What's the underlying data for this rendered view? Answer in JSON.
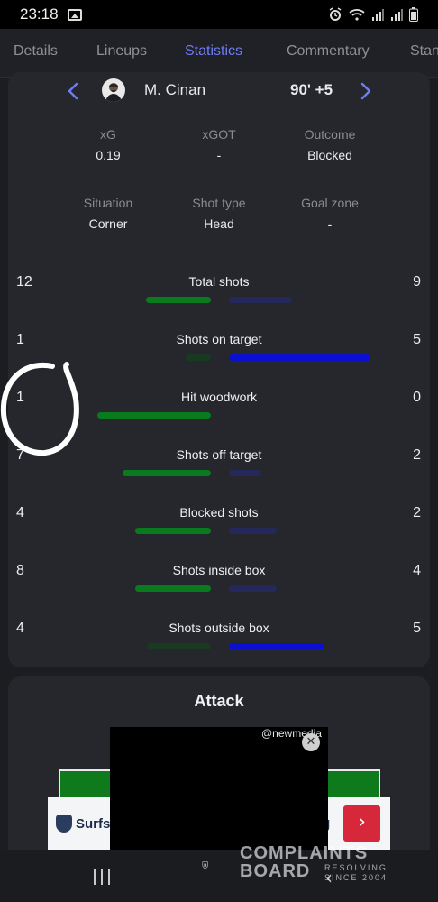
{
  "status_bar": {
    "time": "23:18"
  },
  "tabs": [
    {
      "label": "Details"
    },
    {
      "label": "Lineups"
    },
    {
      "label": "Statistics"
    },
    {
      "label": "Commentary"
    },
    {
      "label": "Stan"
    }
  ],
  "shot": {
    "player_name": "M. Cinan",
    "time": "90' +5",
    "details": [
      {
        "label": "xG",
        "value": "0.19"
      },
      {
        "label": "xGOT",
        "value": "-"
      },
      {
        "label": "Outcome",
        "value": "Blocked"
      },
      {
        "label": "Situation",
        "value": "Corner"
      },
      {
        "label": "Shot type",
        "value": "Head"
      },
      {
        "label": "Goal zone",
        "value": "-"
      }
    ]
  },
  "stats": [
    {
      "label": "Total shots",
      "home": "12",
      "away": "9",
      "home_fraction": 0.57,
      "away_fraction": 0.43
    },
    {
      "label": "Shots on target",
      "home": "1",
      "away": "5",
      "home_fraction": 0.17,
      "away_fraction": 0.83
    },
    {
      "label": "Hit woodwork",
      "home": "1",
      "away": "0",
      "home_fraction": 1.0,
      "away_fraction": 0.0
    },
    {
      "label": "Shots off target",
      "home": "7",
      "away": "2",
      "home_fraction": 0.78,
      "away_fraction": 0.22
    },
    {
      "label": "Blocked shots",
      "home": "4",
      "away": "2",
      "home_fraction": 0.67,
      "away_fraction": 0.33
    },
    {
      "label": "Shots inside box",
      "home": "8",
      "away": "4",
      "home_fraction": 0.67,
      "away_fraction": 0.33
    },
    {
      "label": "Shots outside box",
      "home": "4",
      "away": "5",
      "home_fraction": 0.44,
      "away_fraction": 0.56
    }
  ],
  "colors": {
    "home_strong": "#0a7a1e",
    "home_dim": "#173a20",
    "away_strong": "#0b0fd0",
    "away_dim": "#25285a",
    "accent": "#6e7cf5"
  },
  "attack": {
    "title": "Attack"
  },
  "ad": {
    "credit": "@newmedia",
    "brand": "Surfsł",
    "trailing": "g",
    "cta": "›"
  },
  "watermark": {
    "line1": "COMPLAINTS",
    "line2": "BOARD",
    "tagline_1": "RESOLVING",
    "tagline_2": "SINCE 2004"
  }
}
